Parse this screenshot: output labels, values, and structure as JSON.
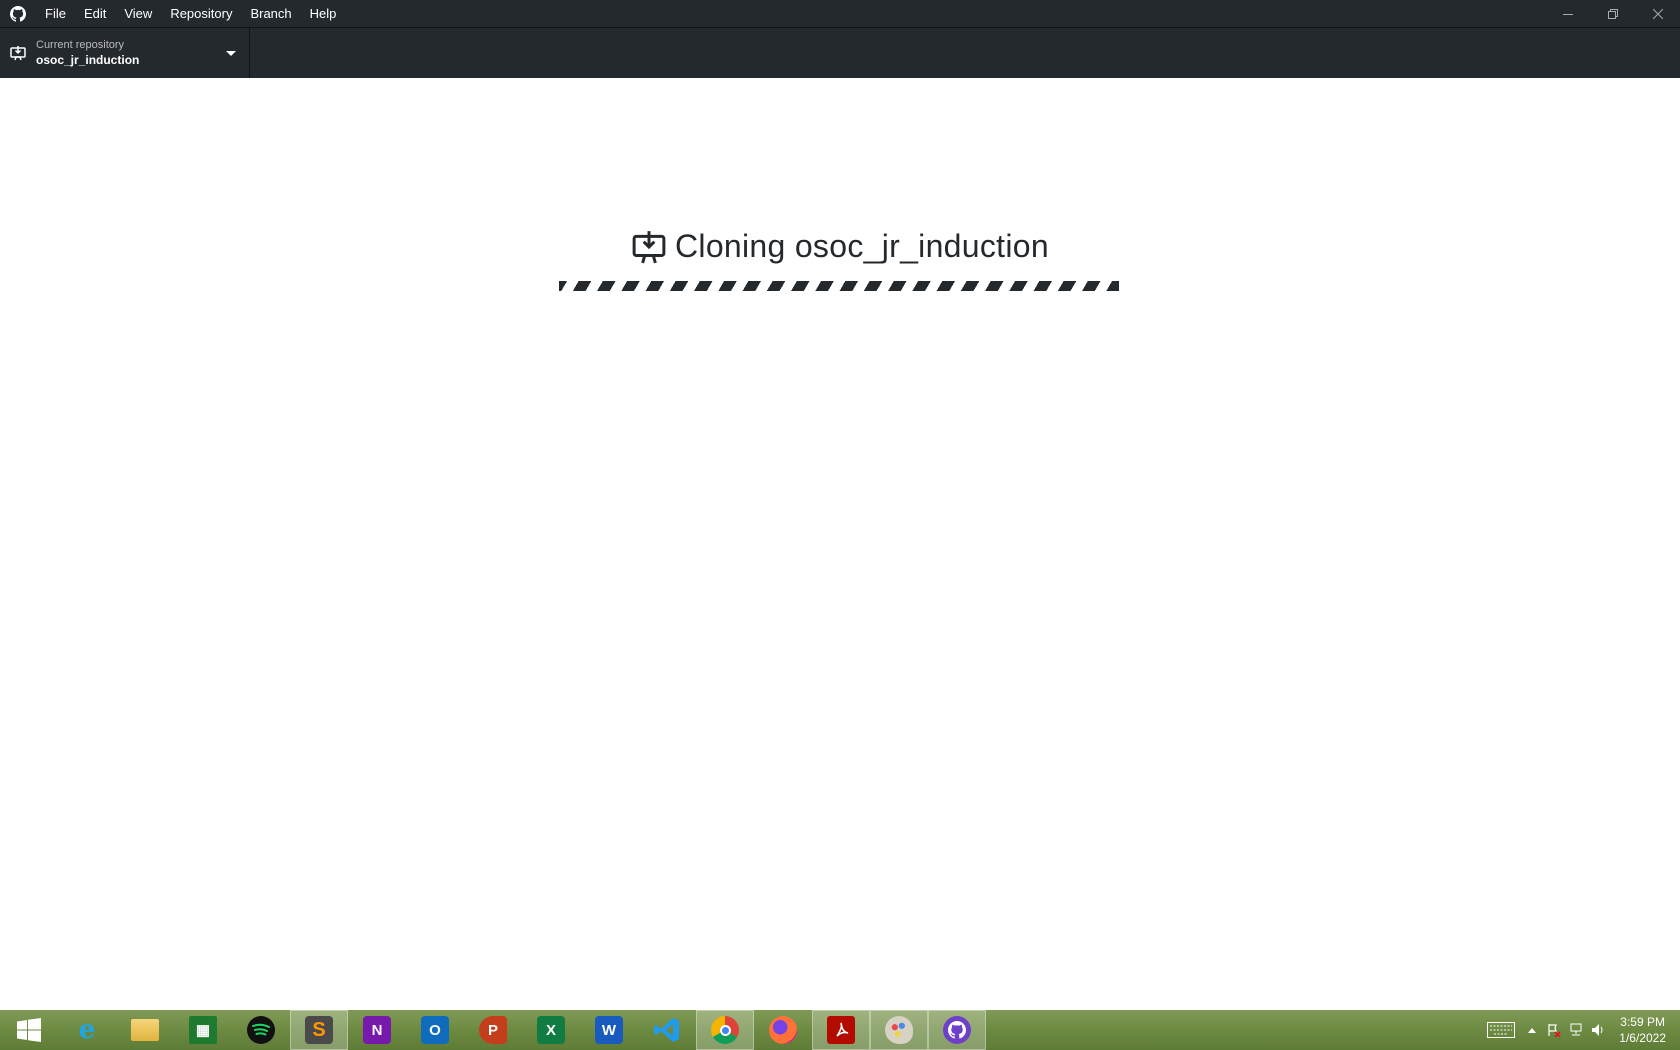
{
  "menu": {
    "items": [
      "File",
      "Edit",
      "View",
      "Repository",
      "Branch",
      "Help"
    ]
  },
  "repo_selector": {
    "caption": "Current repository",
    "name": "osoc_jr_induction"
  },
  "clone": {
    "title": "Cloning osoc_jr_induction"
  },
  "colors": {
    "chrome": "#24292e",
    "text": "#24292e",
    "background": "#ffffff"
  },
  "taskbar": {
    "apps": [
      "start-icon",
      "internet-explorer-icon",
      "file-explorer-icon",
      "store-icon",
      "spotify-icon",
      "sublime-text-icon",
      "onenote-icon",
      "outlook-icon",
      "powerpoint-icon",
      "excel-icon",
      "word-icon",
      "vscode-icon",
      "chrome-icon",
      "firefox-icon",
      "acrobat-icon",
      "paint-icon",
      "github-desktop-icon"
    ],
    "clock_time": "3:59 PM",
    "clock_date": "1/6/2022"
  }
}
